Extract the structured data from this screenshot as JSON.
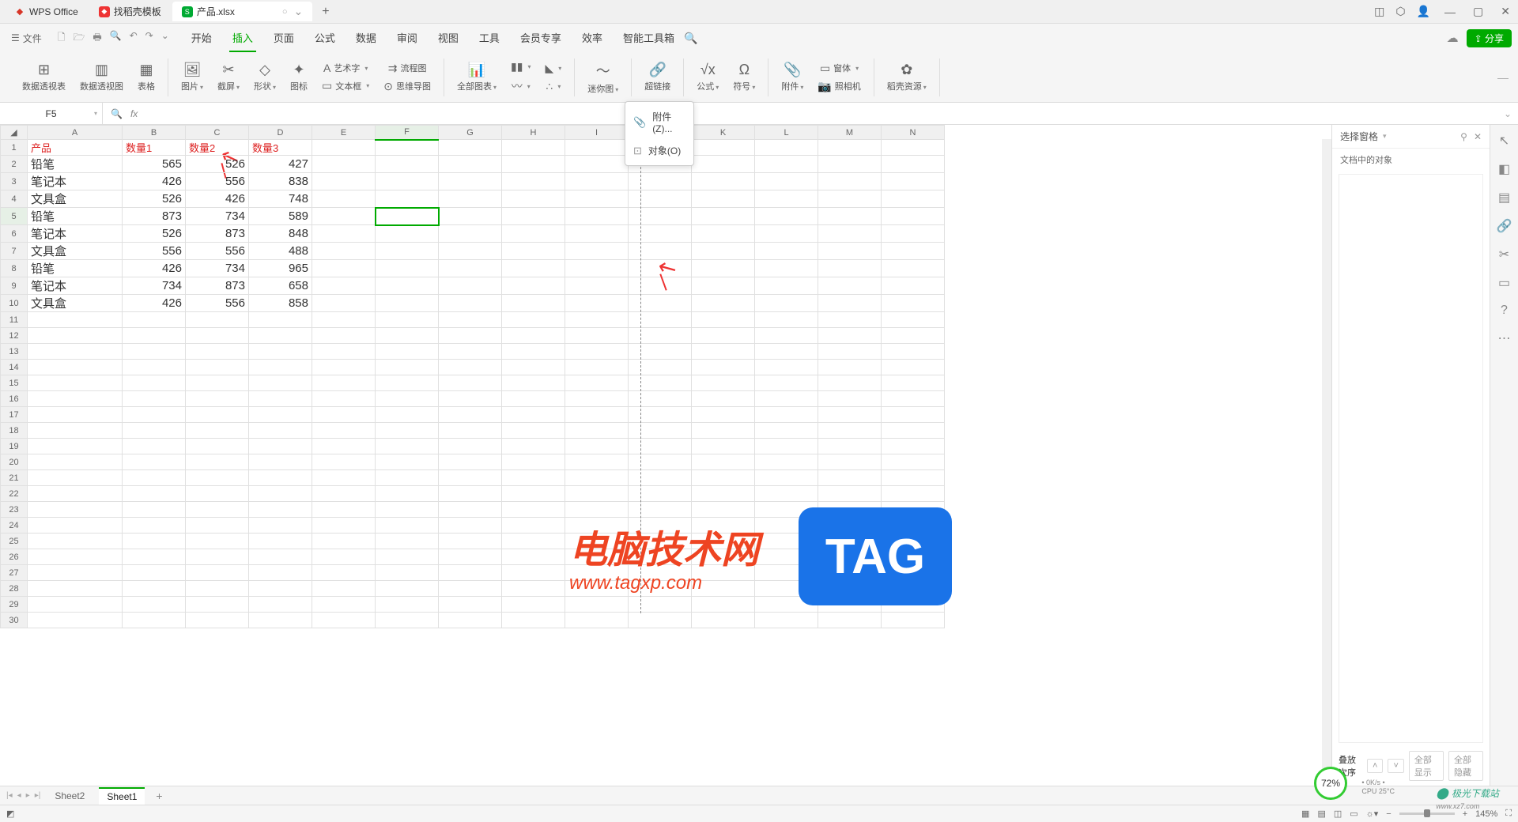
{
  "titlebar": {
    "app_name": "WPS Office",
    "tab1": "找稻壳模板",
    "tab2": "产品.xlsx",
    "add": "+",
    "win_min": "—",
    "win_max": "▢",
    "win_close": "✕"
  },
  "menubar": {
    "file": "文件",
    "tabs": [
      "开始",
      "插入",
      "页面",
      "公式",
      "数据",
      "审阅",
      "视图",
      "工具",
      "会员专享",
      "效率",
      "智能工具箱"
    ],
    "active_tab_index": 1,
    "share": "分享"
  },
  "ribbon": {
    "pivot_table": "数据透视表",
    "pivot_chart": "数据透视图",
    "table": "表格",
    "picture": "图片",
    "screenshot": "截屏",
    "shapes": "形状",
    "icon": "图标",
    "wordart": "艺术字",
    "textbox": "文本框",
    "flowchart": "流程图",
    "mindmap": "思维导图",
    "all_charts": "全部图表",
    "sparkline": "迷你图",
    "hyperlink": "超链接",
    "formula": "公式",
    "symbol": "符号",
    "attachment": "附件",
    "window": "窗体",
    "camera": "照相机",
    "resources": "稻壳资源"
  },
  "dropdown": {
    "item1": "附件(Z)...",
    "item2": "对象(O)"
  },
  "formula": {
    "namebox": "F5",
    "fx": "fx"
  },
  "cols": [
    "A",
    "B",
    "C",
    "D",
    "E",
    "F",
    "G",
    "H",
    "I",
    "J",
    "K",
    "L",
    "M",
    "N"
  ],
  "headers": [
    "产品",
    "数量1",
    "数量2",
    "数量3"
  ],
  "rows": [
    {
      "p": "铅笔",
      "a": 565,
      "b": 526,
      "c": 427
    },
    {
      "p": "笔记本",
      "a": 426,
      "b": 556,
      "c": 838
    },
    {
      "p": "文具盒",
      "a": 526,
      "b": 426,
      "c": 748
    },
    {
      "p": "铅笔",
      "a": 873,
      "b": 734,
      "c": 589
    },
    {
      "p": "笔记本",
      "a": 526,
      "b": 873,
      "c": 848
    },
    {
      "p": "文具盒",
      "a": 556,
      "b": 556,
      "c": 488
    },
    {
      "p": "铅笔",
      "a": 426,
      "b": 734,
      "c": 965
    },
    {
      "p": "笔记本",
      "a": 734,
      "b": 873,
      "c": 658
    },
    {
      "p": "文具盒",
      "a": 426,
      "b": 556,
      "c": 858
    }
  ],
  "right_pane": {
    "title": "选择窗格",
    "sub": "文档中的对象",
    "sort": "叠放次序",
    "show_all": "全部显示",
    "hide_all": "全部隐藏"
  },
  "sheets": {
    "s2": "Sheet2",
    "s1": "Sheet1"
  },
  "status": {
    "zoom": "145%",
    "perf": "72%",
    "net": "0K/s",
    "cpu": "CPU 25°C"
  },
  "watermark": {
    "text": "电脑技术网",
    "url": "www.tagxp.com",
    "tag": "TAG",
    "site": "极光下载站",
    "site_url": "www.xz7.com"
  }
}
